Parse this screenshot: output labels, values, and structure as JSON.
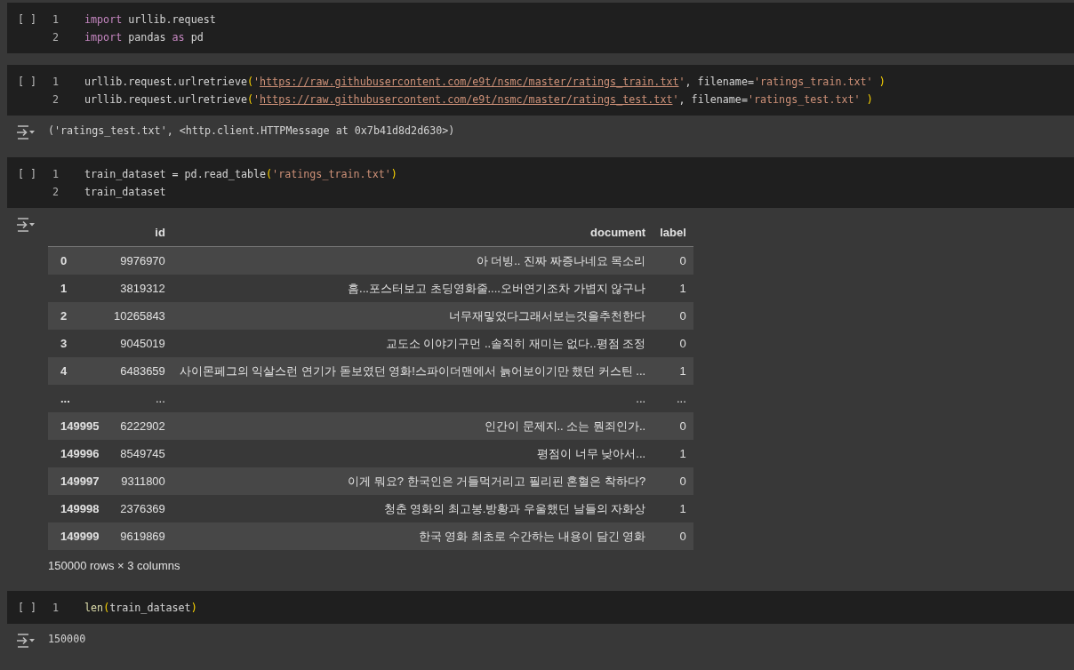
{
  "cells": [
    {
      "run_label": "[ ]",
      "lines": [
        {
          "number": "1",
          "tokens": [
            {
              "kind": "keyword",
              "text": "import"
            },
            {
              "kind": "plain",
              "text": " urllib.request"
            }
          ]
        },
        {
          "number": "2",
          "tokens": [
            {
              "kind": "keyword",
              "text": "import"
            },
            {
              "kind": "plain",
              "text": " pandas "
            },
            {
              "kind": "keyword",
              "text": "as"
            },
            {
              "kind": "plain",
              "text": " pd"
            }
          ]
        }
      ]
    },
    {
      "run_label": "[ ]",
      "lines": [
        {
          "number": "1",
          "tokens": [
            {
              "kind": "plain",
              "text": "urllib.request.urlretrieve"
            },
            {
              "kind": "paren",
              "text": "("
            },
            {
              "kind": "string",
              "text": "'"
            },
            {
              "kind": "link",
              "text": "https://raw.githubusercontent.com/e9t/nsmc/master/ratings_train.txt"
            },
            {
              "kind": "string",
              "text": "'"
            },
            {
              "kind": "plain",
              "text": ", filename="
            },
            {
              "kind": "string",
              "text": "'ratings_train.txt'"
            },
            {
              "kind": "paren",
              "text": " )"
            }
          ]
        },
        {
          "number": "2",
          "tokens": [
            {
              "kind": "plain",
              "text": "urllib.request.urlretrieve"
            },
            {
              "kind": "paren",
              "text": "("
            },
            {
              "kind": "string",
              "text": "'"
            },
            {
              "kind": "link",
              "text": "https://raw.githubusercontent.com/e9t/nsmc/master/ratings_test.txt"
            },
            {
              "kind": "string",
              "text": "'"
            },
            {
              "kind": "plain",
              "text": ", filename="
            },
            {
              "kind": "string",
              "text": "'ratings_test.txt'"
            },
            {
              "kind": "paren",
              "text": " )"
            }
          ]
        }
      ],
      "output": {
        "kind": "text",
        "text": "('ratings_test.txt', <http.client.HTTPMessage at 0x7b41d8d2d630>)"
      }
    },
    {
      "run_label": "[ ]",
      "lines": [
        {
          "number": "1",
          "tokens": [
            {
              "kind": "plain",
              "text": "train_dataset = pd.read_table"
            },
            {
              "kind": "paren",
              "text": "("
            },
            {
              "kind": "string",
              "text": "'ratings_train.txt'"
            },
            {
              "kind": "paren",
              "text": ")"
            }
          ]
        },
        {
          "number": "2",
          "tokens": [
            {
              "kind": "plain",
              "text": "train_dataset"
            }
          ]
        }
      ],
      "output": {
        "kind": "table",
        "columns": [
          "id",
          "document",
          "label"
        ],
        "rows": [
          {
            "index": "0",
            "cells": [
              "9976970",
              "아 더빙.. 진짜 짜증나네요 목소리",
              "0"
            ]
          },
          {
            "index": "1",
            "cells": [
              "3819312",
              "흠...포스터보고 초딩영화줄....오버연기조차 가볍지 않구나",
              "1"
            ]
          },
          {
            "index": "2",
            "cells": [
              "10265843",
              "너무재밓었다그래서보는것을추천한다",
              "0"
            ]
          },
          {
            "index": "3",
            "cells": [
              "9045019",
              "교도소 이야기구먼 ..솔직히 재미는 없다..평점 조정",
              "0"
            ]
          },
          {
            "index": "4",
            "cells": [
              "6483659",
              "사이몬페그의 익살스런 연기가 돋보였던 영화!스파이더맨에서 늙어보이기만 했던 커스틴 ...",
              "1"
            ]
          },
          {
            "index": "...",
            "cells": [
              "...",
              "...",
              "..."
            ]
          },
          {
            "index": "149995",
            "cells": [
              "6222902",
              "인간이 문제지.. 소는 뭔죄인가..",
              "0"
            ]
          },
          {
            "index": "149996",
            "cells": [
              "8549745",
              "평점이 너무 낮아서...",
              "1"
            ]
          },
          {
            "index": "149997",
            "cells": [
              "9311800",
              "이게 뭐요? 한국인은 거들먹거리고 필리핀 혼혈은 착하다?",
              "0"
            ]
          },
          {
            "index": "149998",
            "cells": [
              "2376369",
              "청춘 영화의 최고봉.방황과 우울했던 날들의 자화상",
              "1"
            ]
          },
          {
            "index": "149999",
            "cells": [
              "9619869",
              "한국 영화 최초로 수간하는 내용이 담긴 영화",
              "0"
            ]
          }
        ],
        "footer": "150000 rows × 3 columns"
      }
    },
    {
      "run_label": "[ ]",
      "lines": [
        {
          "number": "1",
          "tokens": [
            {
              "kind": "function",
              "text": "len"
            },
            {
              "kind": "paren",
              "text": "("
            },
            {
              "kind": "plain",
              "text": "train_dataset"
            },
            {
              "kind": "paren",
              "text": ")"
            }
          ]
        }
      ],
      "output": {
        "kind": "text",
        "text": "150000"
      }
    }
  ]
}
